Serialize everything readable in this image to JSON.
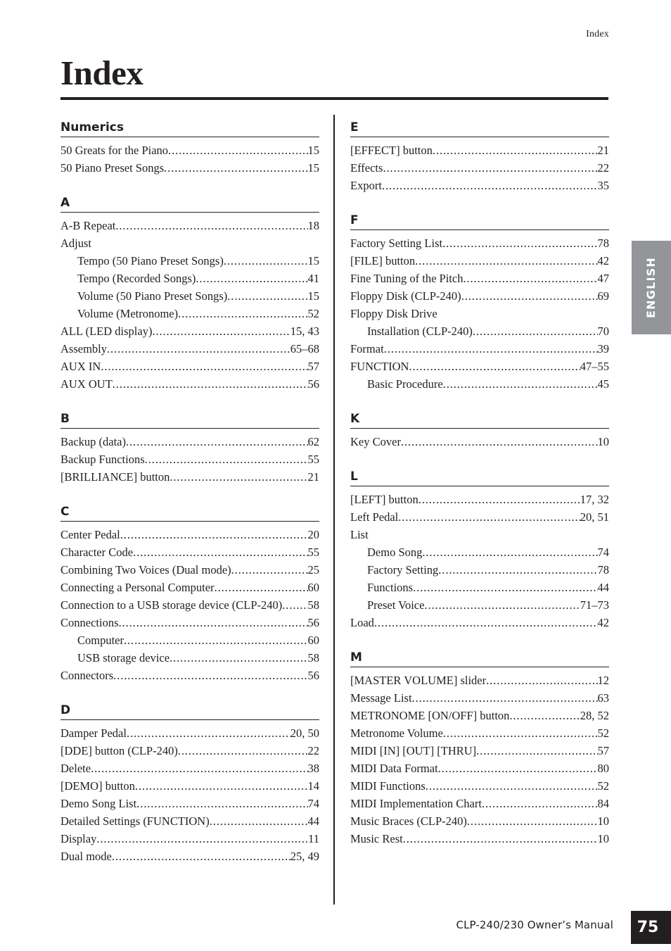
{
  "running_head": "Index",
  "page_title": "Index",
  "side_tab": {
    "label": "ENGLISH",
    "background": "#939598",
    "text_color": "#ffffff"
  },
  "footer": {
    "manual_title": "CLP-240/230 Owner’s Manual",
    "page_number": "75",
    "box_color": "#231f20"
  },
  "columns": [
    {
      "id": "left",
      "sections": [
        {
          "letter": "Numerics",
          "entries": [
            {
              "label": "50 Greats for the Piano",
              "page": "15",
              "sub": false
            },
            {
              "label": "50 Piano Preset Songs",
              "page": "15",
              "sub": false
            }
          ]
        },
        {
          "letter": "A",
          "entries": [
            {
              "label": "A-B Repeat",
              "page": "18",
              "sub": false
            },
            {
              "label": "Adjust",
              "page": "",
              "sub": false
            },
            {
              "label": "Tempo (50 Piano Preset Songs)",
              "page": "15",
              "sub": true
            },
            {
              "label": "Tempo (Recorded Songs)",
              "page": "41",
              "sub": true
            },
            {
              "label": "Volume (50 Piano Preset Songs)",
              "page": "15",
              "sub": true
            },
            {
              "label": "Volume (Metronome)",
              "page": "52",
              "sub": true
            },
            {
              "label": "ALL (LED display)",
              "page": "15, 43",
              "sub": false
            },
            {
              "label": "Assembly",
              "page": "65–68",
              "sub": false
            },
            {
              "label": "AUX IN",
              "page": "57",
              "sub": false
            },
            {
              "label": "AUX OUT",
              "page": "56",
              "sub": false
            }
          ]
        },
        {
          "letter": "B",
          "entries": [
            {
              "label": "Backup (data)",
              "page": "62",
              "sub": false
            },
            {
              "label": "Backup Functions",
              "page": "55",
              "sub": false
            },
            {
              "label": "[BRILLIANCE] button",
              "page": "21",
              "sub": false
            }
          ]
        },
        {
          "letter": "C",
          "entries": [
            {
              "label": "Center Pedal",
              "page": "20",
              "sub": false
            },
            {
              "label": "Character Code",
              "page": "55",
              "sub": false
            },
            {
              "label": "Combining Two Voices (Dual mode)",
              "page": "25",
              "sub": false
            },
            {
              "label": "Connecting a Personal Computer",
              "page": "60",
              "sub": false
            },
            {
              "label": "Connection to a USB storage device (CLP-240)",
              "page": "58",
              "sub": false
            },
            {
              "label": "Connections",
              "page": "56",
              "sub": false
            },
            {
              "label": "Computer",
              "page": "60",
              "sub": true
            },
            {
              "label": "USB storage device",
              "page": "58",
              "sub": true
            },
            {
              "label": "Connectors",
              "page": "56",
              "sub": false
            }
          ]
        },
        {
          "letter": "D",
          "entries": [
            {
              "label": "Damper Pedal",
              "page": "20, 50",
              "sub": false
            },
            {
              "label": "[DDE] button (CLP-240)",
              "page": "22",
              "sub": false
            },
            {
              "label": "Delete",
              "page": "38",
              "sub": false
            },
            {
              "label": "[DEMO] button",
              "page": "14",
              "sub": false
            },
            {
              "label": "Demo Song List",
              "page": "74",
              "sub": false
            },
            {
              "label": "Detailed Settings (FUNCTION)",
              "page": "44",
              "sub": false
            },
            {
              "label": "Display",
              "page": "11",
              "sub": false
            },
            {
              "label": "Dual mode",
              "page": "25, 49",
              "sub": false
            }
          ]
        }
      ]
    },
    {
      "id": "right",
      "sections": [
        {
          "letter": "E",
          "entries": [
            {
              "label": "[EFFECT] button",
              "page": "21",
              "sub": false
            },
            {
              "label": "Effects",
              "page": "22",
              "sub": false
            },
            {
              "label": "Export",
              "page": "35",
              "sub": false
            }
          ]
        },
        {
          "letter": "F",
          "entries": [
            {
              "label": "Factory Setting List",
              "page": "78",
              "sub": false
            },
            {
              "label": "[FILE] button",
              "page": "42",
              "sub": false
            },
            {
              "label": "Fine Tuning of the Pitch",
              "page": "47",
              "sub": false
            },
            {
              "label": "Floppy Disk (CLP-240)",
              "page": "69",
              "sub": false
            },
            {
              "label": "Floppy Disk Drive",
              "page": "",
              "sub": false
            },
            {
              "label": "Installation (CLP-240)",
              "page": "70",
              "sub": true
            },
            {
              "label": "Format",
              "page": "39",
              "sub": false
            },
            {
              "label": "FUNCTION",
              "page": "47–55",
              "sub": false
            },
            {
              "label": "Basic Procedure",
              "page": "45",
              "sub": true
            }
          ]
        },
        {
          "letter": "K",
          "entries": [
            {
              "label": "Key Cover",
              "page": "10",
              "sub": false
            }
          ]
        },
        {
          "letter": "L",
          "entries": [
            {
              "label": "[LEFT] button",
              "page": "17, 32",
              "sub": false
            },
            {
              "label": "Left Pedal",
              "page": "20, 51",
              "sub": false
            },
            {
              "label": "List",
              "page": "",
              "sub": false
            },
            {
              "label": "Demo Song",
              "page": "74",
              "sub": true
            },
            {
              "label": "Factory Setting",
              "page": "78",
              "sub": true
            },
            {
              "label": "Functions",
              "page": "44",
              "sub": true
            },
            {
              "label": "Preset Voice",
              "page": "71–73",
              "sub": true
            },
            {
              "label": "Load",
              "page": "42",
              "sub": false
            }
          ]
        },
        {
          "letter": "M",
          "entries": [
            {
              "label": "[MASTER VOLUME] slider",
              "page": "12",
              "sub": false
            },
            {
              "label": "Message List",
              "page": "63",
              "sub": false
            },
            {
              "label": "METRONOME [ON/OFF] button",
              "page": "28, 52",
              "sub": false
            },
            {
              "label": "Metronome Volume",
              "page": "52",
              "sub": false
            },
            {
              "label": "MIDI [IN] [OUT] [THRU]",
              "page": "57",
              "sub": false
            },
            {
              "label": "MIDI Data Format",
              "page": "80",
              "sub": false
            },
            {
              "label": "MIDI Functions",
              "page": "52",
              "sub": false
            },
            {
              "label": "MIDI Implementation Chart",
              "page": "84",
              "sub": false
            },
            {
              "label": "Music Braces (CLP-240)",
              "page": "10",
              "sub": false
            },
            {
              "label": "Music Rest",
              "page": "10",
              "sub": false
            }
          ]
        }
      ]
    }
  ]
}
